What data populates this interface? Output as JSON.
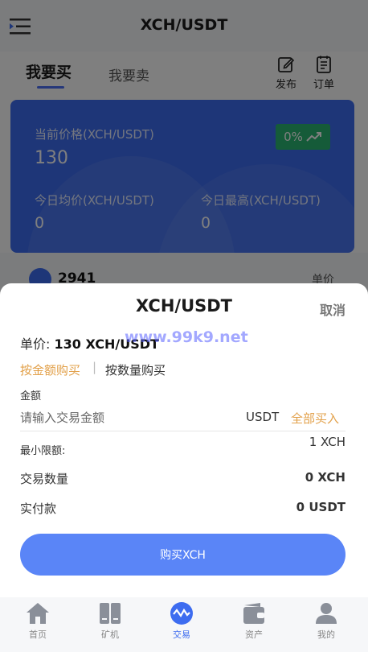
{
  "header": {
    "title": "XCH/USDT"
  },
  "tabs": {
    "buy": "我要买",
    "sell": "我要卖"
  },
  "actions": {
    "publish": "发布",
    "orders": "订单"
  },
  "card": {
    "price_label": "当前价格(XCH/USDT)",
    "price_value": "130",
    "change": "0%",
    "avg_label": "今日均价(XCH/USDT)",
    "avg_value": "0",
    "high_label": "今日最高(XCH/USDT)",
    "high_value": "0"
  },
  "list_peek": {
    "number": "2941",
    "unit_label": "单价"
  },
  "sheet": {
    "title": "XCH/USDT",
    "cancel": "取消",
    "price_label": "单价:",
    "price_value": "130 XCH/USDT",
    "watermark": "www.99k9.net",
    "mode_amount": "按金额购买",
    "mode_sep": "|",
    "mode_quantity": "按数量购买",
    "amount_label": "金额",
    "amount_placeholder": "请输入交易金额",
    "amount_unit": "USDT",
    "buy_all": "全部买入",
    "min_label": "最小限额:",
    "min_value": "1 XCH",
    "qty_label": "交易数量",
    "qty_value": "0 XCH",
    "paid_label": "实付款",
    "paid_value": "0 USDT",
    "buy_button": "购买XCH"
  },
  "tabbar": {
    "items": [
      {
        "label": "首页",
        "icon": "home-icon"
      },
      {
        "label": "矿机",
        "icon": "miner-icon"
      },
      {
        "label": "交易",
        "icon": "trade-icon"
      },
      {
        "label": "资产",
        "icon": "wallet-icon"
      },
      {
        "label": "我的",
        "icon": "user-icon"
      }
    ],
    "active": "交易"
  },
  "colors": {
    "accent": "#3d6cf0",
    "button": "#5a85f7",
    "orange": "#e2a049",
    "up": "#2bb673"
  }
}
